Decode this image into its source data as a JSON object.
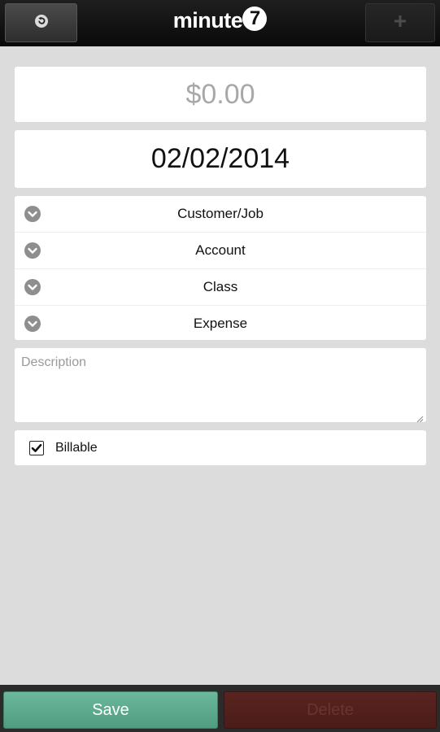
{
  "header": {
    "logo_text": "minute",
    "logo_badge": "7",
    "back_icon": "refresh-back-icon",
    "add_icon": "plus-icon"
  },
  "form": {
    "amount": "$0.00",
    "date": "02/02/2014",
    "pickers": [
      {
        "label": "Customer/Job",
        "icon": "chevron-down-icon"
      },
      {
        "label": "Account",
        "icon": "chevron-down-icon"
      },
      {
        "label": "Class",
        "icon": "chevron-down-icon"
      },
      {
        "label": "Expense",
        "icon": "chevron-down-icon"
      }
    ],
    "description_placeholder": "Description",
    "description_value": "",
    "billable_label": "Billable",
    "billable_checked": true
  },
  "footer": {
    "save_label": "Save",
    "delete_label": "Delete"
  },
  "colors": {
    "save": "#5aa78b",
    "delete": "#52201d",
    "background": "#dcdcdc"
  }
}
